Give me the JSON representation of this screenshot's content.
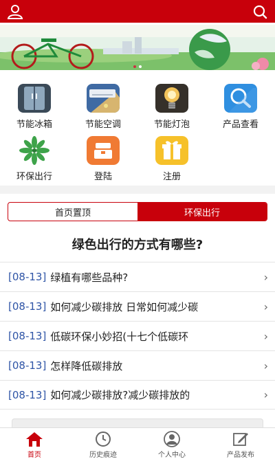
{
  "header": {
    "user_icon": "user-icon",
    "search_icon": "search-icon",
    "accent": "#c8000b"
  },
  "grid": {
    "items": [
      {
        "label": "节能冰箱",
        "icon": "refrigerator-icon"
      },
      {
        "label": "节能空调",
        "icon": "air-conditioner-icon"
      },
      {
        "label": "节能灯泡",
        "icon": "light-bulb-icon"
      },
      {
        "label": "产品查看",
        "icon": "search-product-icon"
      },
      {
        "label": "环保出行",
        "icon": "leaf-icon"
      },
      {
        "label": "登陆",
        "icon": "login-icon"
      },
      {
        "label": "注册",
        "icon": "gift-icon"
      }
    ]
  },
  "tabs": [
    {
      "label": "首页置顶",
      "active": false
    },
    {
      "label": "环保出行",
      "active": true
    }
  ],
  "headline": "绿色出行的方式有哪些?",
  "list": [
    {
      "date": "[08-13]",
      "title": "绿植有哪些品种?"
    },
    {
      "date": "[08-13]",
      "title": "如何减少碳排放 日常如何减少碳"
    },
    {
      "date": "[08-13]",
      "title": "低碳环保小妙招(十七个低碳环"
    },
    {
      "date": "[08-13]",
      "title": "怎样降低碳排放"
    },
    {
      "date": "[08-13]",
      "title": "如何减少碳排放?减少碳排放的"
    }
  ],
  "bottom_nav": [
    {
      "label": "首页",
      "icon": "home-icon",
      "active": true
    },
    {
      "label": "历史痕迹",
      "icon": "clock-icon",
      "active": false
    },
    {
      "label": "个人中心",
      "icon": "person-icon",
      "active": false
    },
    {
      "label": "产品发布",
      "icon": "edit-icon",
      "active": false
    }
  ]
}
